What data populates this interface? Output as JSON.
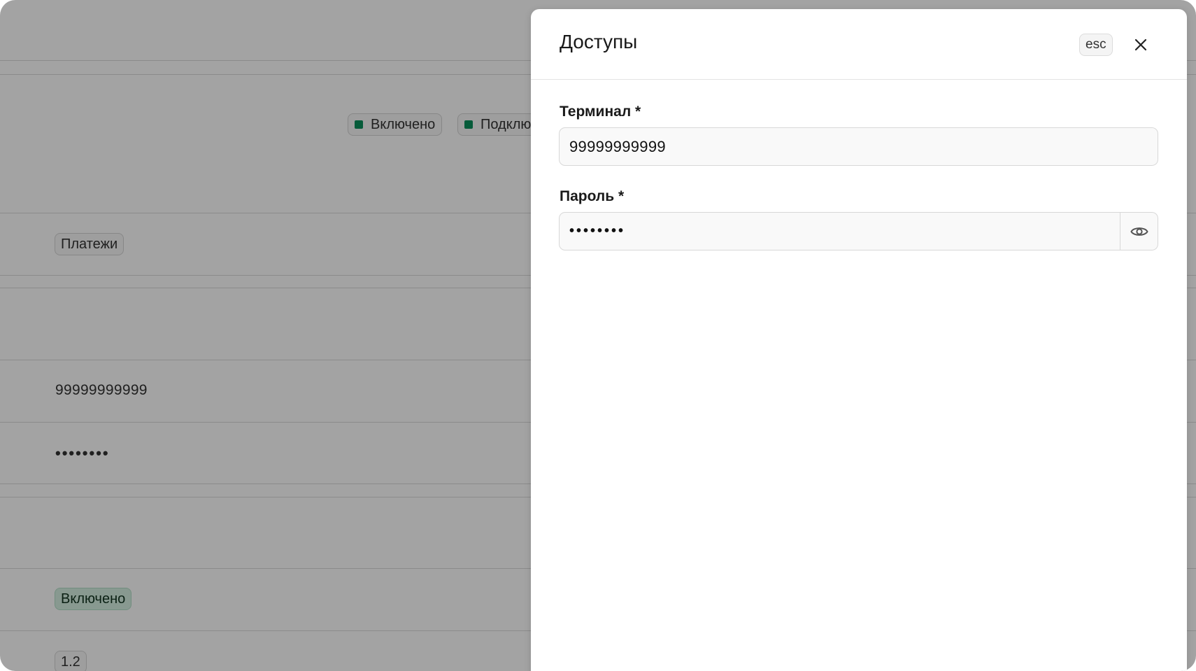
{
  "background": {
    "status_badge_enabled": "Включено",
    "status_badge_connected": "Подключ",
    "section_tag": "Платежи",
    "terminal_value": "99999999999",
    "password_value": "••••••••",
    "enabled_tag": "Включено",
    "version_tag": "1.2"
  },
  "dialog": {
    "title": "Доступы",
    "esc_hint": "esc",
    "terminal_label": "Терминал *",
    "terminal_value": "99999999999",
    "password_label": "Пароль *",
    "password_value": "••••••••"
  },
  "colors": {
    "accent_green": "#0a8f5c",
    "overlay": "rgba(0,0,0,0.36)"
  },
  "icons": {
    "close": "close-icon",
    "eye": "eye-icon"
  }
}
